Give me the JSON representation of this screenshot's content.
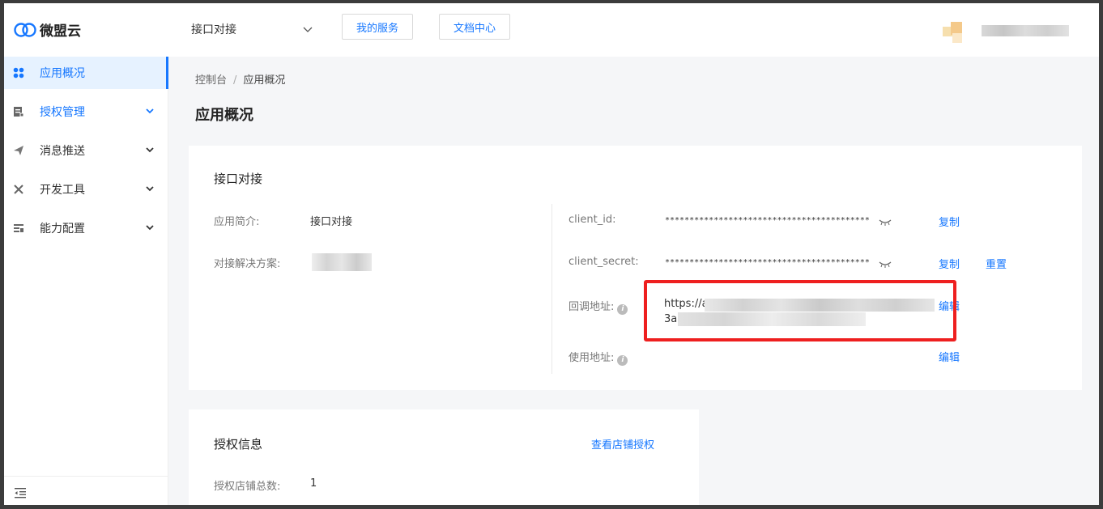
{
  "brand": {
    "name": "微盟云",
    "accent": "#1677ff"
  },
  "header": {
    "app_selector": "接口对接",
    "btn_services": "我的服务",
    "btn_docs": "文档中心"
  },
  "sidebar": {
    "items": [
      {
        "label": "应用概况",
        "icon": "app-grid-icon",
        "active": true
      },
      {
        "label": "授权管理",
        "icon": "document-icon",
        "expanded": true
      },
      {
        "label": "消息推送",
        "icon": "send-icon"
      },
      {
        "label": "开发工具",
        "icon": "tools-icon"
      },
      {
        "label": "能力配置",
        "icon": "config-icon"
      }
    ]
  },
  "breadcrumb": {
    "root": "控制台",
    "sep": "/",
    "current": "应用概况"
  },
  "page_title": "应用概况",
  "integration": {
    "title": "接口对接",
    "intro_label": "应用简介:",
    "intro_value": "接口对接",
    "solution_label": "对接解决方案:",
    "client_id_label": "client_id:",
    "client_id_value": "******************************************",
    "client_secret_label": "client_secret:",
    "client_secret_value": "******************************************",
    "callback_label": "回调地址:",
    "callback_line1": "https://ap",
    "callback_line2": "3a",
    "usage_label": "使用地址:",
    "copy": "复制",
    "reset": "重置",
    "edit": "编辑",
    "info_glyph": "i"
  },
  "auth_info": {
    "title": "授权信息",
    "view_link": "查看店铺授权",
    "total_label": "授权店铺总数:",
    "total_value": "1"
  }
}
